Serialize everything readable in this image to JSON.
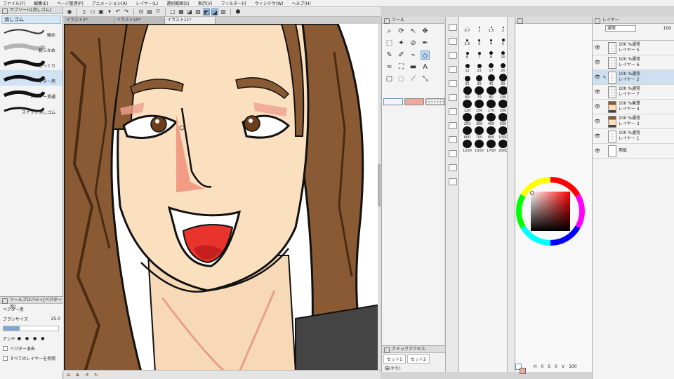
{
  "menu": [
    "ファイル(F)",
    "編集(E)",
    "ページ管理(P)",
    "アニメーション(A)",
    "レイヤー(L)",
    "選択範囲(S)",
    "表示(V)",
    "フィルター(I)",
    "ウィンドウ(W)",
    "ヘルプ(H)"
  ],
  "subtool": {
    "panel_title": "サブツール[消しゴム]",
    "group": "消しゴム",
    "items": [
      "硬め",
      "軟らかめ",
      "ざっくり",
      "ベクター用",
      "レイヤー貫通",
      "スナップ消しゴム"
    ]
  },
  "tool_property": {
    "title": "ツールプロパティ[ベクター用]",
    "tool_name": "ベクター用",
    "brush_size_label": "ブラシサイズ",
    "brush_size_value": "25.0",
    "antialias_label": "アンチ",
    "vector_erase_label": "ベクター消去",
    "all_layers_label": "すべてのレイヤーを参照"
  },
  "canvas_tabs": [
    "イラスト2*",
    "イラスト10*",
    "イラスト11*"
  ],
  "canvas_tab_active": 2,
  "tool_palette": {
    "title": "ツール",
    "main_color": "#ffffff",
    "sub_color": "#f2a79c"
  },
  "quick_access": {
    "title": "クイックアクセス",
    "tabs": [
      "セット1",
      "セット2"
    ],
    "item": "描(やり)"
  },
  "brush_sizes": [
    "0.7",
    "1",
    "1.5",
    "2",
    "2.5",
    "3",
    "4",
    "5",
    "6",
    "7",
    "8",
    "10",
    "12",
    "15",
    "17",
    "20",
    "25",
    "30",
    "40",
    "50",
    "60",
    "70",
    "80",
    "100",
    "120",
    "150",
    "170",
    "200",
    "250",
    "300",
    "400",
    "500",
    "600",
    "700",
    "800",
    "1000",
    "1200",
    "1500",
    "1700",
    "2000"
  ],
  "color": {
    "hue": "#ff0000",
    "swatch_main": "#ffffff",
    "swatch_sub": "#f2a79c",
    "footer": [
      "H",
      "0",
      "S",
      "0",
      "V",
      "100"
    ]
  },
  "layers": {
    "title": "レイヤー",
    "blend_mode": "通常",
    "opacity": "100",
    "items": [
      {
        "mode": "100 %通常",
        "name": "レイヤー 5",
        "selected": false,
        "thumb": "empty"
      },
      {
        "mode": "100 %通常",
        "name": "レイヤー 6",
        "selected": false,
        "thumb": "empty"
      },
      {
        "mode": "100 %通常",
        "name": "レイヤー 2",
        "selected": true,
        "thumb": "vector"
      },
      {
        "mode": "100 %通常",
        "name": "レイヤー 7",
        "selected": false,
        "thumb": "empty"
      },
      {
        "mode": "100 %乗算",
        "name": "レイヤー 4",
        "selected": false,
        "thumb": "art"
      },
      {
        "mode": "100 %通常",
        "name": "レイヤー 3",
        "selected": false,
        "thumb": "art2"
      },
      {
        "mode": "100 %通常",
        "name": "レイヤー 1",
        "selected": false,
        "thumb": "vector"
      },
      {
        "mode": "",
        "name": "用紙",
        "selected": false,
        "thumb": "paper"
      }
    ]
  }
}
